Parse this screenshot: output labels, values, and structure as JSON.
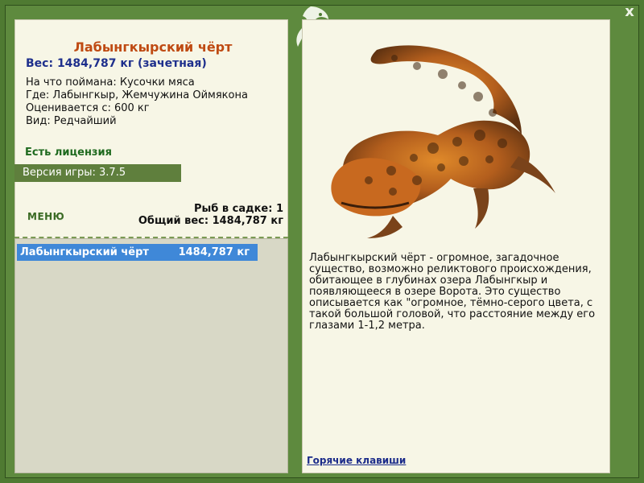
{
  "window": {
    "close_label": "x"
  },
  "fish": {
    "name": "Лабынгкырский чёрт",
    "weight_line": "Вес: 1484,787 кг (зачетная)",
    "caught_on": "На что поймана: Кусочки мяса",
    "where": "Где: Лабынгкыр, Жемчужина Оймякона",
    "valued_from": "Оценивается с: 600 кг",
    "kind": "Вид: Редчайший",
    "image_icon": "giant-salamander-illustration"
  },
  "license": {
    "text": "Есть лицензия"
  },
  "version": {
    "text": "Версия игры: 3.7.5"
  },
  "menu": {
    "label": "МЕНЮ"
  },
  "keepnet": {
    "count_text": "Рыб в садке: 1",
    "total_weight_text": "Общий вес: 1484,787 кг"
  },
  "list": {
    "items": [
      {
        "name": "Лабынгкырский чёрт",
        "weight": "1484,787 кг"
      }
    ]
  },
  "description": {
    "text": "Лабынгкырский чёрт - огромное, загадочное существо, возможно реликтового происхождения, обитающее в глубинах озера Лабынгкыр и появляющееся в озере Ворота. Это существо описывается как \"огромное, тёмно-серого цвета, с такой большой головой, что расстояние между его глазами 1-1,2 метра."
  },
  "hotkeys": {
    "label": "Горячие клавиши"
  },
  "colors": {
    "frame": "#4f7a32",
    "panel": "#f7f6e6",
    "title": "#bf4a12",
    "weight": "#1e2f8c",
    "selected_row": "#3f88d8"
  }
}
